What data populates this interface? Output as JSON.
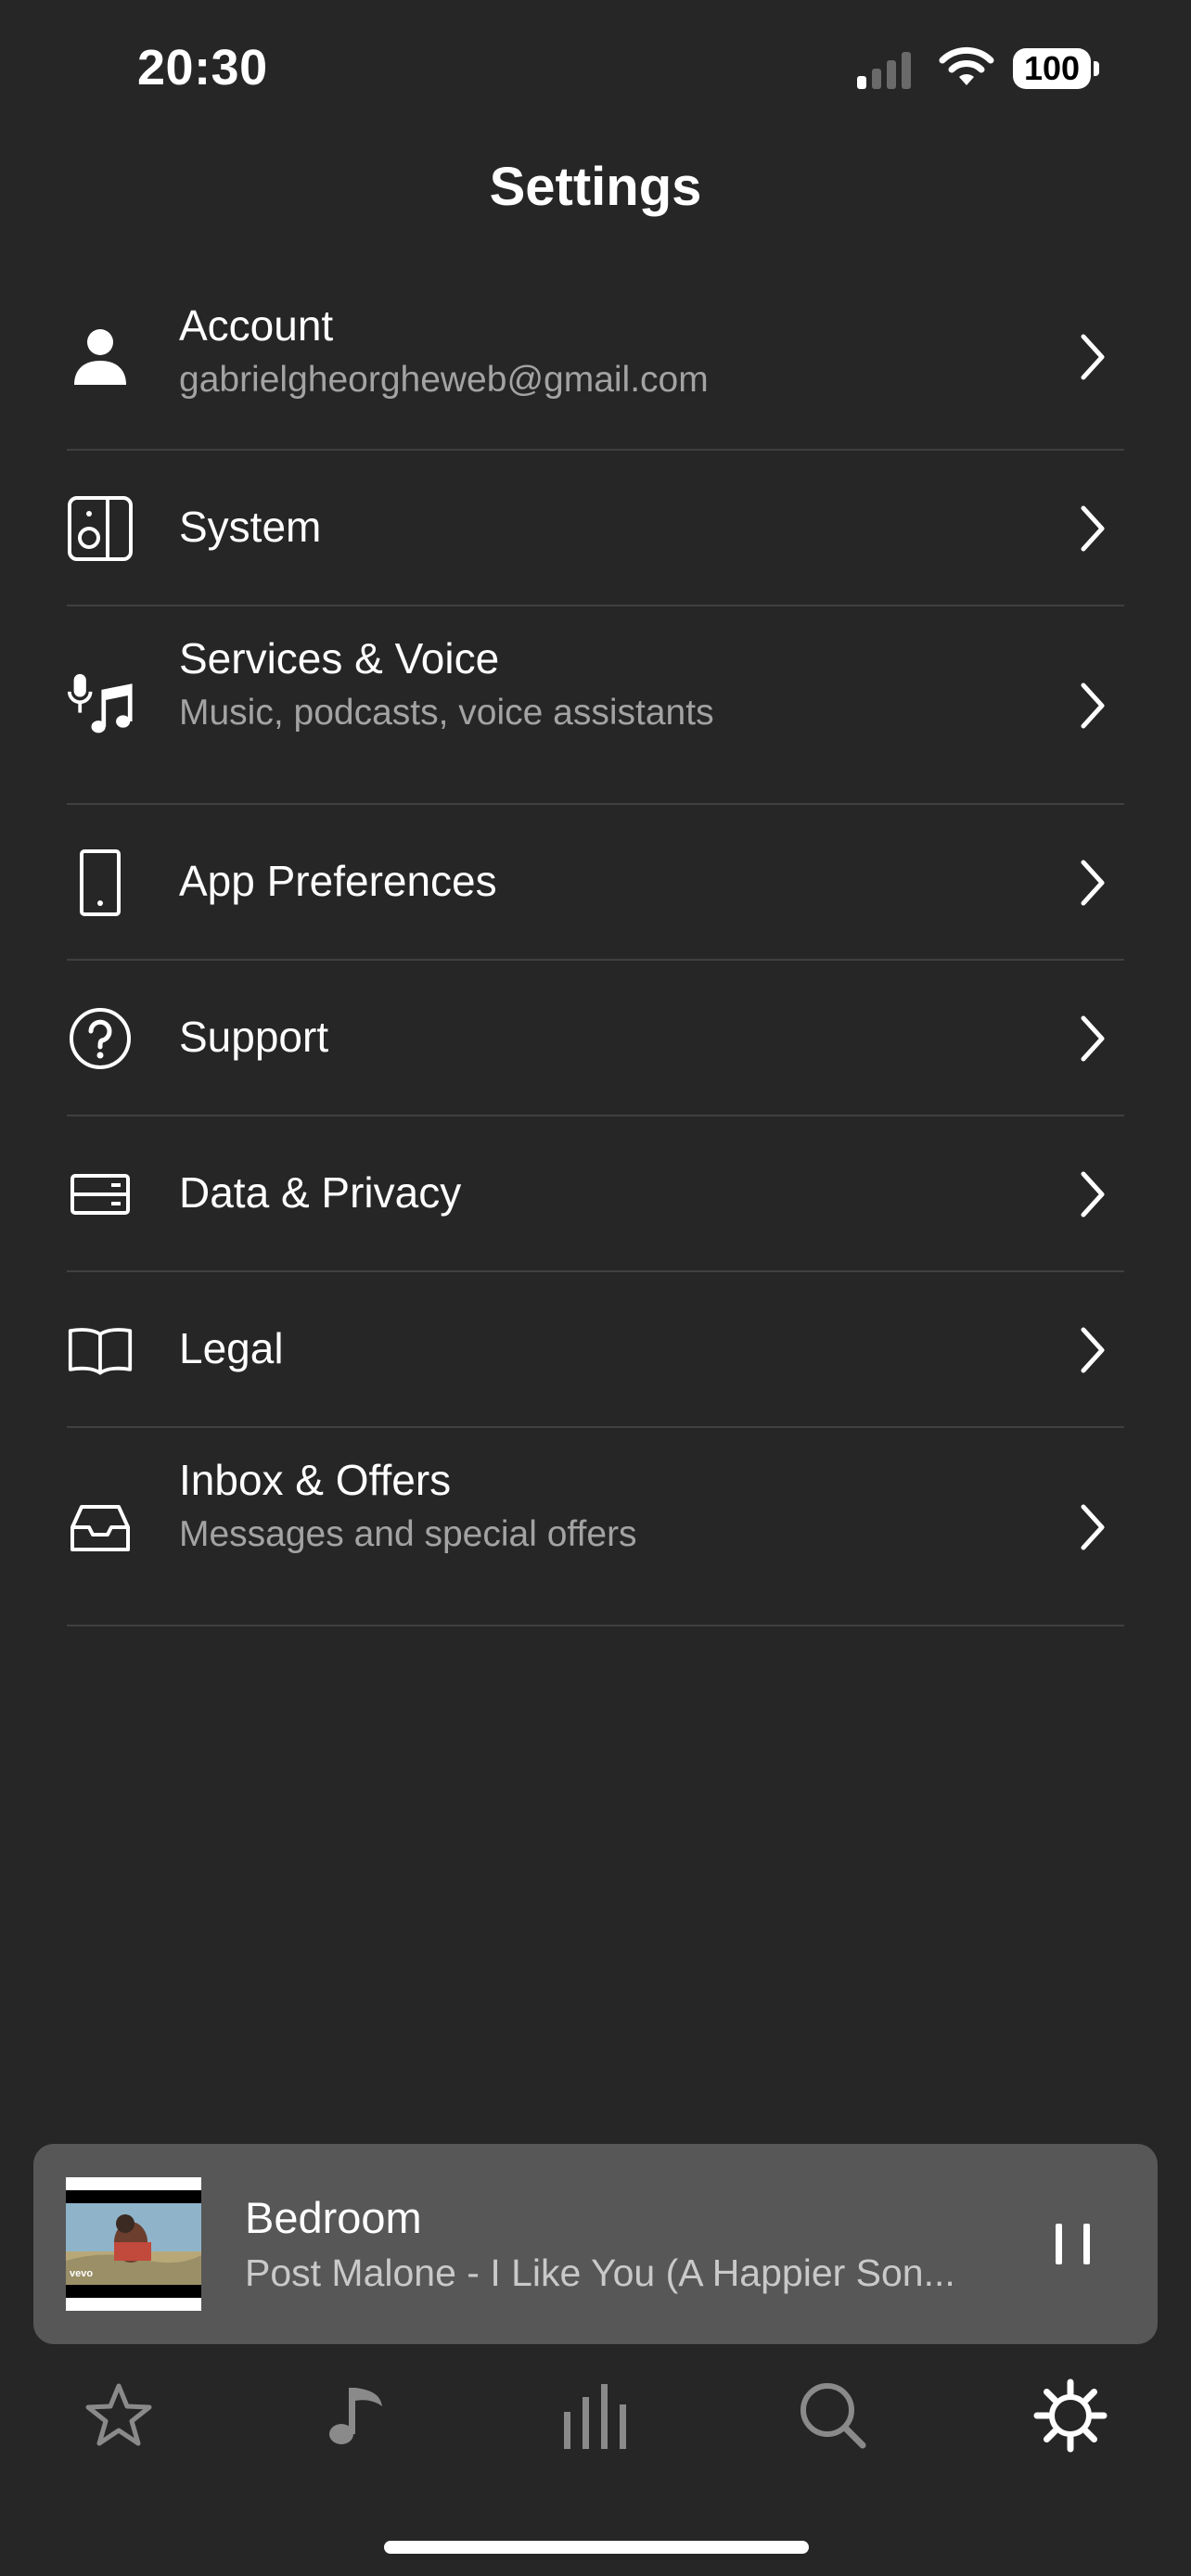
{
  "status_bar": {
    "time": "20:30",
    "battery": "100"
  },
  "header": {
    "title": "Settings"
  },
  "settings": [
    {
      "id": "account",
      "label": "Account",
      "subtitle": "gabrielgheorgheweb@gmail.com",
      "icon": "person-icon"
    },
    {
      "id": "system",
      "label": "System",
      "subtitle": "",
      "icon": "speaker-icon"
    },
    {
      "id": "services-voice",
      "label": "Services & Voice",
      "subtitle": "Music, podcasts, voice assistants",
      "icon": "mic-music-icon"
    },
    {
      "id": "app-preferences",
      "label": "App Preferences",
      "subtitle": "",
      "icon": "phone-icon"
    },
    {
      "id": "support",
      "label": "Support",
      "subtitle": "",
      "icon": "question-circle-icon"
    },
    {
      "id": "data-privacy",
      "label": "Data & Privacy",
      "subtitle": "",
      "icon": "storage-icon"
    },
    {
      "id": "legal",
      "label": "Legal",
      "subtitle": "",
      "icon": "book-icon"
    },
    {
      "id": "inbox-offers",
      "label": "Inbox & Offers",
      "subtitle": "Messages and special offers",
      "icon": "inbox-icon"
    }
  ],
  "now_playing": {
    "room": "Bedroom",
    "track": "Post Malone - I Like You (A Happier Son...",
    "art_watermark": "vevo"
  },
  "tab_bar": {
    "tabs": [
      {
        "name": "favorites",
        "icon": "star-icon",
        "active": false
      },
      {
        "name": "browse",
        "icon": "music-note-icon",
        "active": false
      },
      {
        "name": "rooms",
        "icon": "bars-icon",
        "active": false
      },
      {
        "name": "search",
        "icon": "search-icon",
        "active": false
      },
      {
        "name": "settings",
        "icon": "gear-icon",
        "active": true
      }
    ]
  },
  "colors": {
    "background": "#262626",
    "text_primary": "#ffffff",
    "text_secondary": "#a3a3a3",
    "divider": "#404040",
    "player_bg": "#575757",
    "tab_inactive": "#8a8a8a",
    "tab_active": "#ffffff"
  }
}
